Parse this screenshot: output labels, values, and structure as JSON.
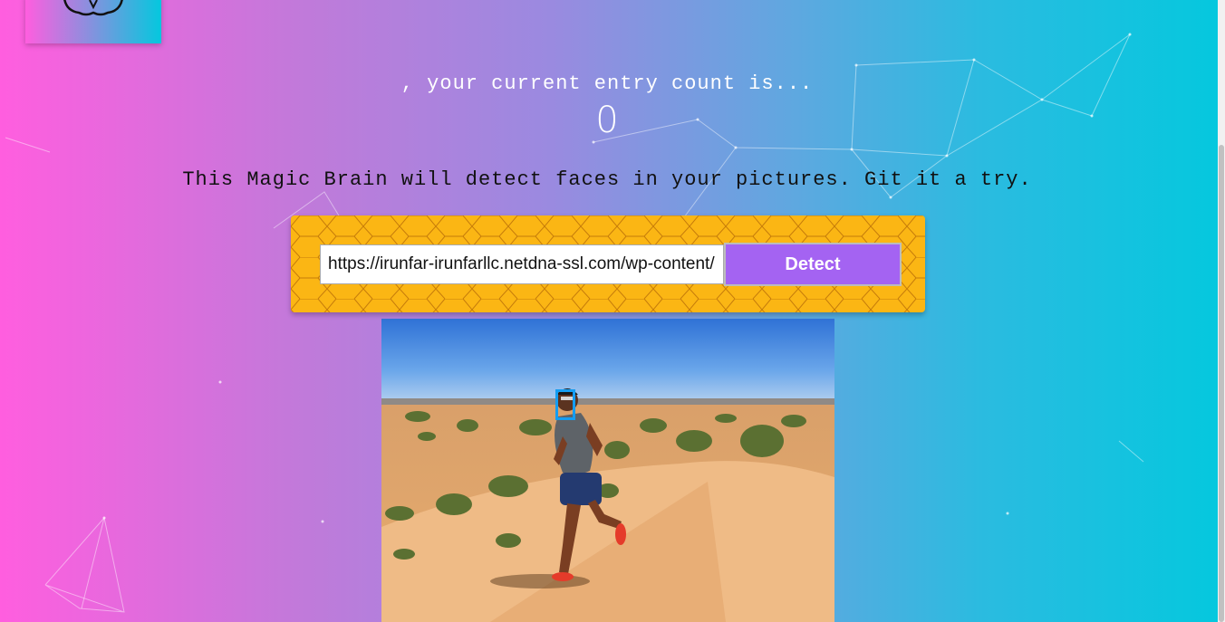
{
  "header": {
    "entry_text": ", your current entry count is...",
    "entry_count": "0"
  },
  "tagline": "This Magic Brain will detect faces in your pictures. Git it a try.",
  "form": {
    "url_value": "https://irunfar-irunfarllc.netdna-ssl.com/wp-content/",
    "detect_label": "Detect"
  },
  "logo": {
    "icon": "brain-icon"
  },
  "colors": {
    "panel": "#fbb614",
    "button": "#a463f2",
    "face_box": "#149df2"
  }
}
